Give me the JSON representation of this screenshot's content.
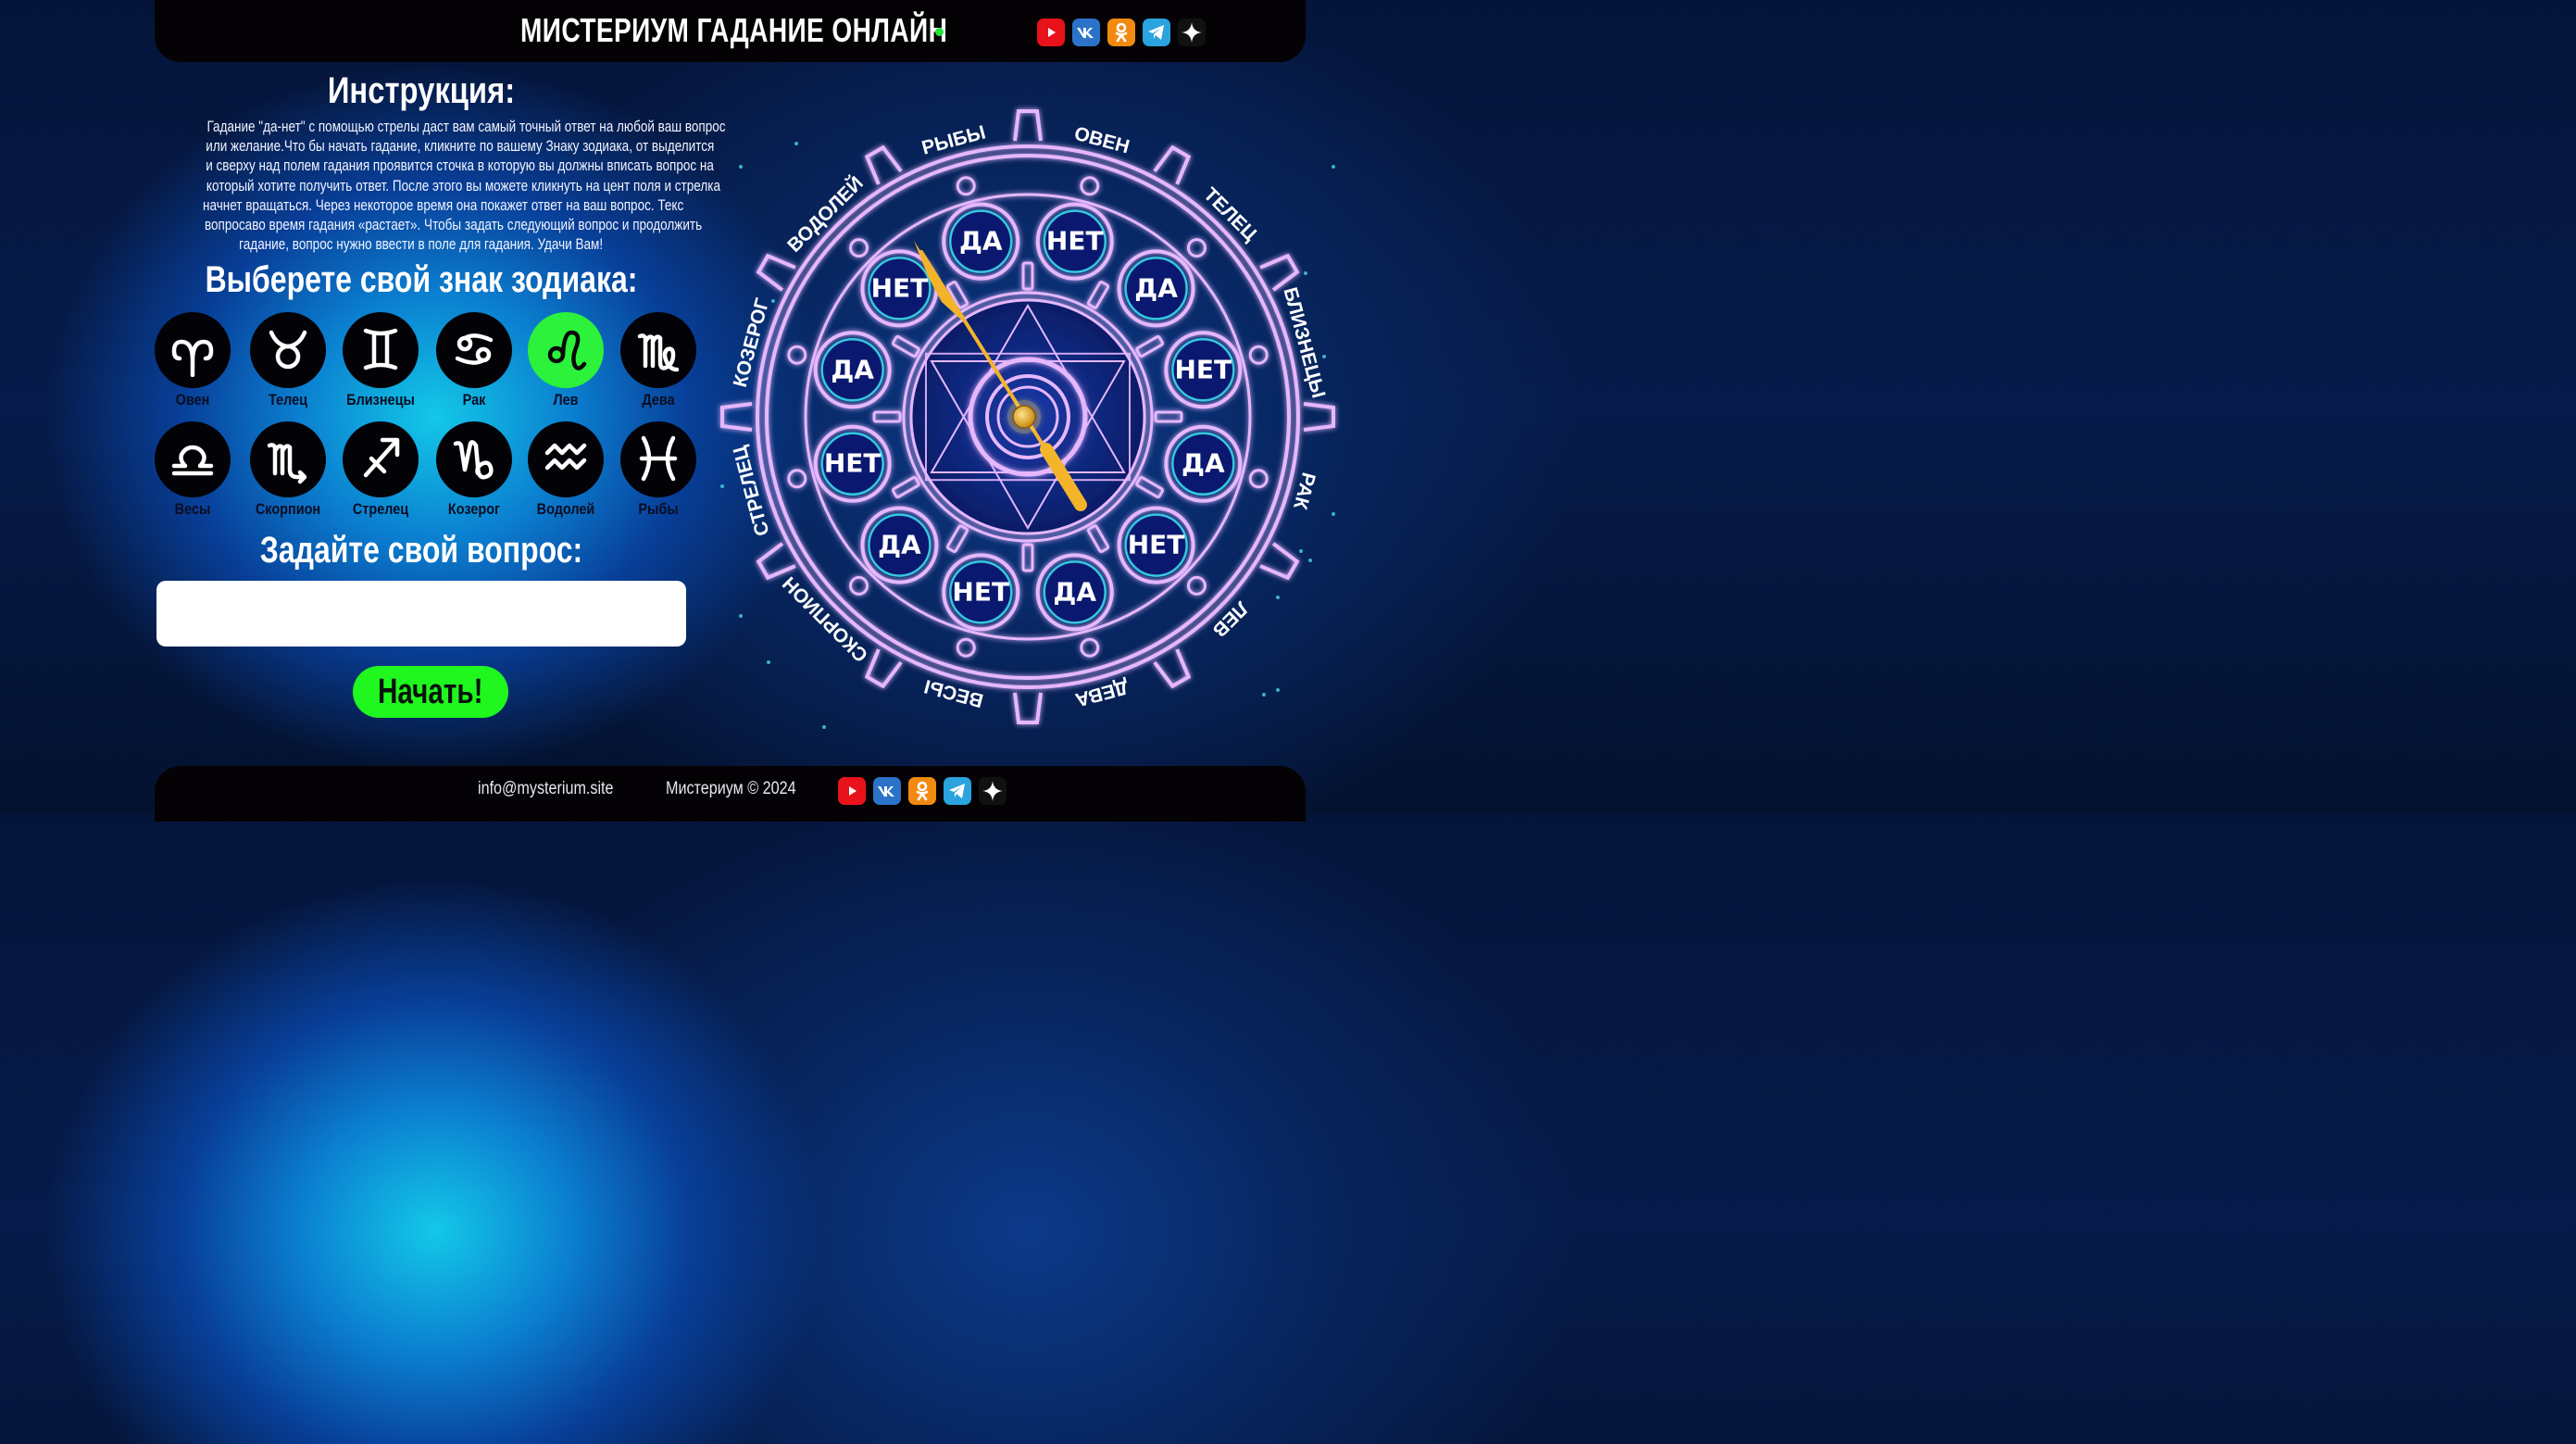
{
  "header": {
    "title": "МИСТЕРИУМ ГАДАНИЕ ОНЛАЙН",
    "socials": [
      {
        "name": "youtube-icon",
        "color": "#e8121b"
      },
      {
        "name": "vk-icon",
        "color": "#2b73c9"
      },
      {
        "name": "odnoklassniki-icon",
        "color": "#f28a12"
      },
      {
        "name": "telegram-icon",
        "color": "#2aa3df"
      },
      {
        "name": "sparkle-icon",
        "color": "#111111"
      }
    ]
  },
  "instructions": {
    "heading": "Инструкция:",
    "lines": [
      "Гадание \"да-нет\" с помощью стрелы даст вам самый точный ответ на любой ваш вопрос",
      "или желание.Что бы начать гадание, кликните по вашему Знаку зодиака, от выделится",
      "и сверху над полем гадания проявится сточка в которую вы должны вписать вопрос на",
      "который хотите получить ответ. После этого вы можете кликнуть на цент поля и стрелка",
      "начнет вращаться. Через некоторое время она покажет ответ на ваш вопрос. Текс",
      "вопросаво время гадания «растает». Чтобы задать следующий вопрос и продолжить",
      "гадание, вопрос нужно ввести в поле для гадания. Удачи Вам!"
    ]
  },
  "zodiac": {
    "heading": "Выберете свой знак зодиака:",
    "selected": "Лев",
    "signs": [
      {
        "label": "Овен",
        "glyph": "aries"
      },
      {
        "label": "Телец",
        "glyph": "taurus"
      },
      {
        "label": "Близнецы",
        "glyph": "gemini"
      },
      {
        "label": "Рак",
        "glyph": "cancer"
      },
      {
        "label": "Лев",
        "glyph": "leo"
      },
      {
        "label": "Дева",
        "glyph": "virgo"
      },
      {
        "label": "Весы",
        "glyph": "libra"
      },
      {
        "label": "Скорпион",
        "glyph": "scorpio"
      },
      {
        "label": "Стрелец",
        "glyph": "sagittarius"
      },
      {
        "label": "Козерог",
        "glyph": "capricorn"
      },
      {
        "label": "Водолей",
        "glyph": "aquarius"
      },
      {
        "label": "Рыбы",
        "glyph": "pisces"
      }
    ]
  },
  "question": {
    "heading": "Задайте свой вопрос:",
    "input_value": "",
    "input_placeholder": "",
    "start_label": "Начать!"
  },
  "wheel": {
    "answers": [
      "ДА",
      "НЕТ",
      "ДА",
      "НЕТ",
      "ДА",
      "НЕТ",
      "ДА",
      "НЕТ",
      "ДА",
      "НЕТ",
      "ДА",
      "НЕТ"
    ],
    "ring_labels": [
      "РЫБЫ",
      "ОВЕН",
      "ТЕЛЕЦ",
      "БЛИЗНЕЦЫ",
      "РАК",
      "ЛЕВ",
      "ДЕВА",
      "ВЕСЫ",
      "СКОРПИОН",
      "СТРЕЛЕЦ",
      "КОЗЕРОГ",
      "ВОДОЛЕЙ"
    ],
    "neon_color": "#e6b7ff",
    "arrow_color": "#f4b42a"
  },
  "footer": {
    "email": "info@mysterium.site",
    "copyright": "Мистериум © 2024"
  },
  "colors": {
    "accent_green": "#1ff71f",
    "header_bg": "#050205"
  }
}
